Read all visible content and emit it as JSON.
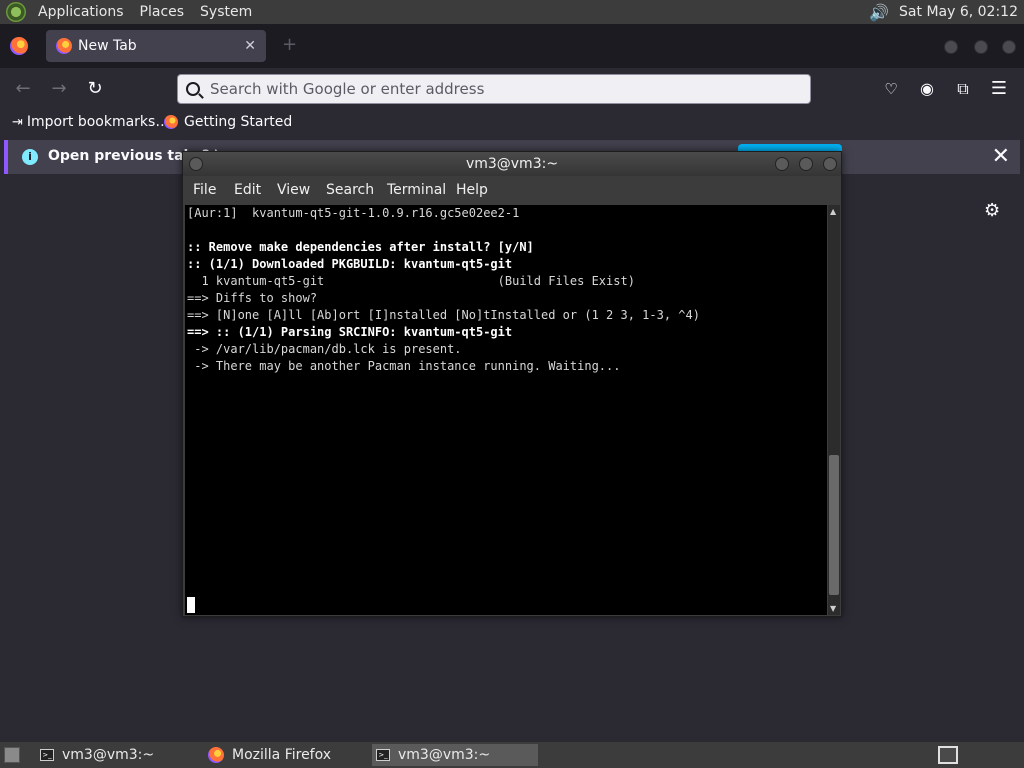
{
  "top_panel": {
    "menus": [
      "Applications",
      "Places",
      "System"
    ],
    "clock": "Sat May  6, 02:12"
  },
  "firefox": {
    "tab_title": "New Tab",
    "url_placeholder": "Search with Google or enter address",
    "bookmarks": [
      "Import bookmarks…",
      "Getting Started"
    ],
    "infobar_text": "Open previous tabs? \\"
  },
  "terminal": {
    "title": "vm3@vm3:~",
    "menus": [
      "File",
      "Edit",
      "View",
      "Search",
      "Terminal",
      "Help"
    ],
    "lines": [
      {
        "text": "[Aur:1]  kvantum-qt5-git-1.0.9.r16.gc5e02ee2-1",
        "bold": false
      },
      {
        "text": "",
        "bold": false
      },
      {
        "text": ":: Remove make dependencies after install? [y/N]",
        "bold": true
      },
      {
        "text": ":: (1/1) Downloaded PKGBUILD: kvantum-qt5-git",
        "bold": true
      },
      {
        "text": "  1 kvantum-qt5-git                        (Build Files Exist)",
        "bold": false
      },
      {
        "text": "==> Diffs to show?",
        "bold": false
      },
      {
        "text": "==> [N]one [A]ll [Ab]ort [I]nstalled [No]tInstalled or (1 2 3, 1-3, ^4)",
        "bold": false
      },
      {
        "text": "==> :: (1/1) Parsing SRCINFO: kvantum-qt5-git",
        "bold": true
      },
      {
        "text": " -> /var/lib/pacman/db.lck is present.",
        "bold": false
      },
      {
        "text": " -> There may be another Pacman instance running. Waiting...",
        "bold": false
      }
    ]
  },
  "taskbar": {
    "tasks": [
      {
        "label": "vm3@vm3:~",
        "icon": "terminal-icon",
        "active": false
      },
      {
        "label": "Mozilla Firefox",
        "icon": "firefox-icon",
        "active": false
      },
      {
        "label": "vm3@vm3:~",
        "icon": "terminal-icon",
        "active": true
      }
    ]
  }
}
